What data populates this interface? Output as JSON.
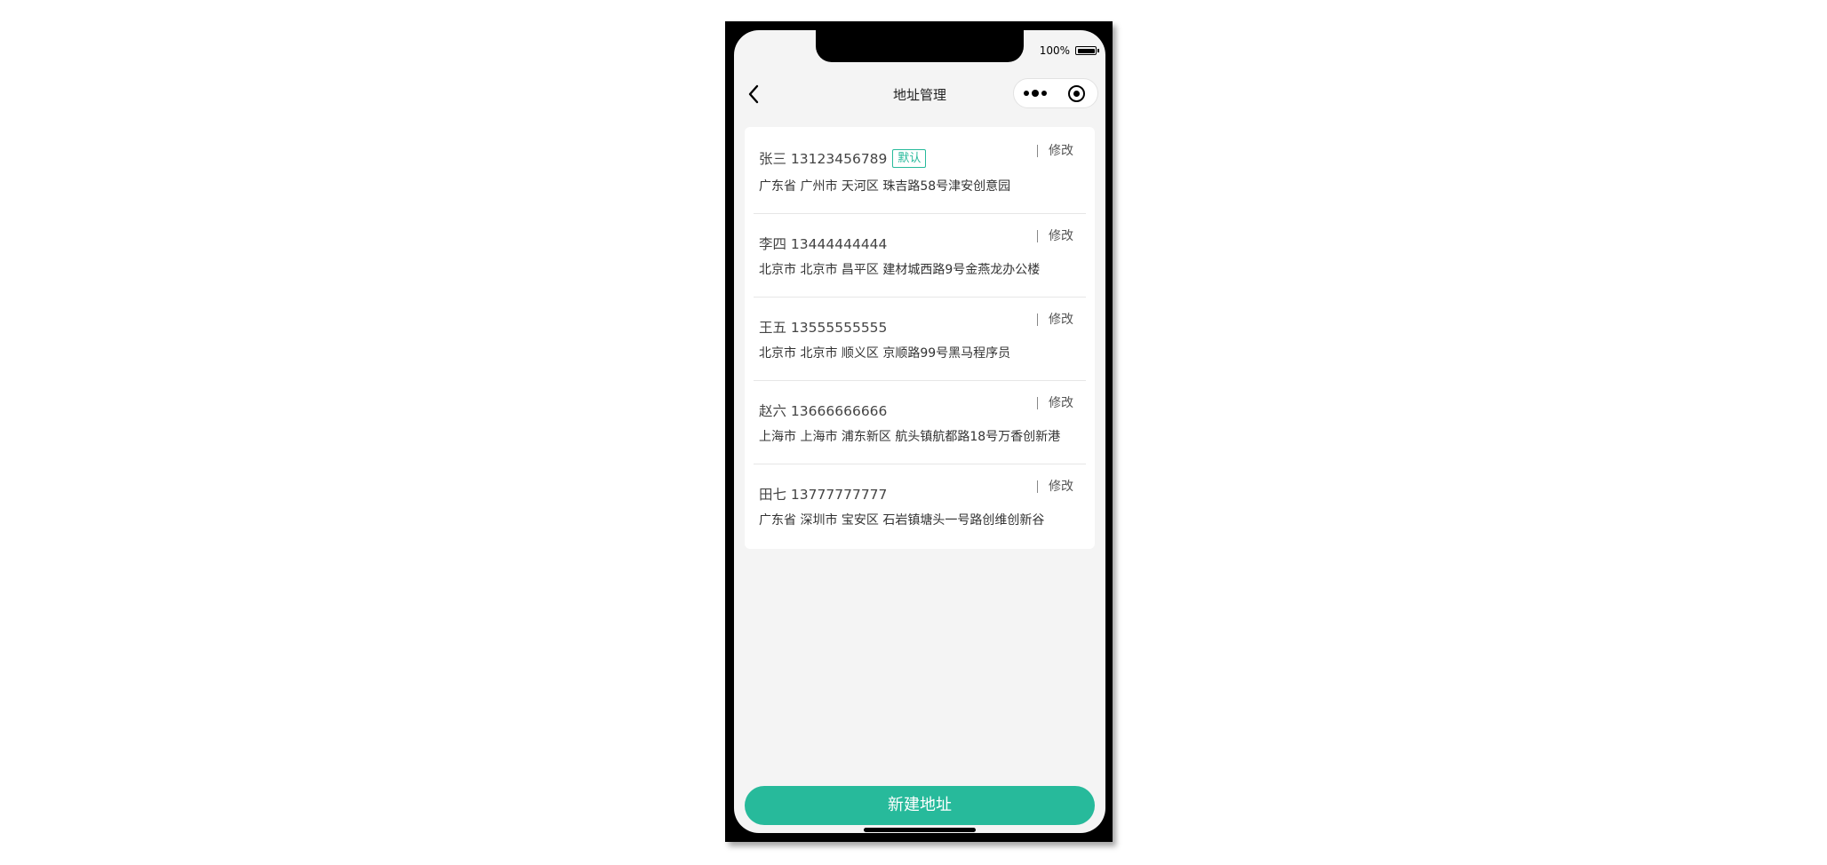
{
  "status_bar": {
    "battery_percent": "100%"
  },
  "nav": {
    "title": "地址管理"
  },
  "addresses": [
    {
      "name_phone": "张三 13123456789",
      "default_badge": "默认",
      "address": "广东省 广州市 天河区 珠吉路58号津安创意园",
      "edit_label": "修改"
    },
    {
      "name_phone": "李四 13444444444",
      "address": "北京市 北京市 昌平区 建材城西路9号金燕龙办公楼",
      "edit_label": "修改"
    },
    {
      "name_phone": "王五 13555555555",
      "address": "北京市 北京市 顺义区 京顺路99号黑马程序员",
      "edit_label": "修改"
    },
    {
      "name_phone": "赵六 13666666666",
      "address": "上海市 上海市 浦东新区 航头镇航都路18号万香创新港",
      "edit_label": "修改"
    },
    {
      "name_phone": "田七 13777777777",
      "address": "广东省 深圳市 宝安区 石岩镇塘头一号路创维创新谷",
      "edit_label": "修改"
    }
  ],
  "add_button_label": "新建地址",
  "colors": {
    "accent": "#27ba9b",
    "background": "#f4f4f4"
  }
}
